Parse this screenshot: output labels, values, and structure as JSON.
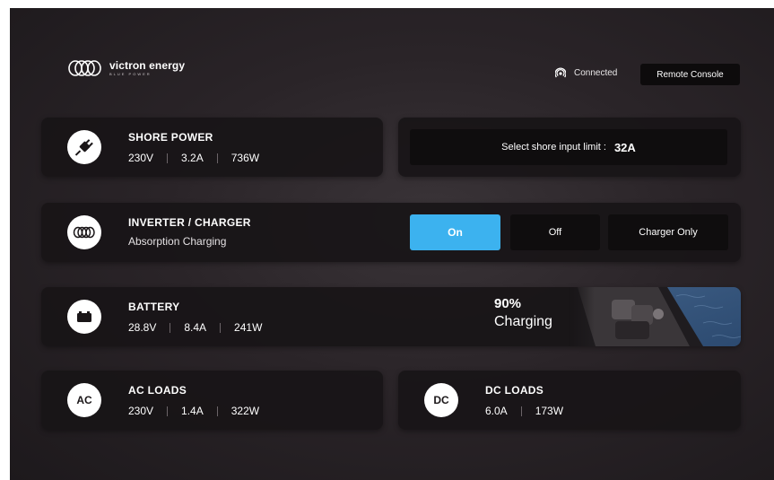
{
  "header": {
    "brand": "victron energy",
    "tagline": "BLUE POWER",
    "connection_status": "Connected",
    "remote_console_label": "Remote Console"
  },
  "shore_power": {
    "title": "SHORE POWER",
    "voltage": "230V",
    "current": "3.2A",
    "power": "736W"
  },
  "shore_limit": {
    "label": "Select shore input limit :",
    "value": "32A"
  },
  "inverter": {
    "title": "INVERTER / CHARGER",
    "status": "Absorption Charging",
    "modes": [
      "On",
      "Off",
      "Charger Only"
    ],
    "active_mode": "On"
  },
  "battery": {
    "title": "BATTERY",
    "voltage": "28.8V",
    "current": "8.4A",
    "power": "241W",
    "percent": "90%",
    "state": "Charging"
  },
  "ac_loads": {
    "icon_label": "AC",
    "title": "AC LOADS",
    "voltage": "230V",
    "current": "1.4A",
    "power": "322W"
  },
  "dc_loads": {
    "icon_label": "DC",
    "title": "DC LOADS",
    "current": "6.0A",
    "power": "173W"
  },
  "colors": {
    "accent": "#3cb2ef",
    "card": "#181517",
    "button_dark": "#0f0d0e"
  }
}
